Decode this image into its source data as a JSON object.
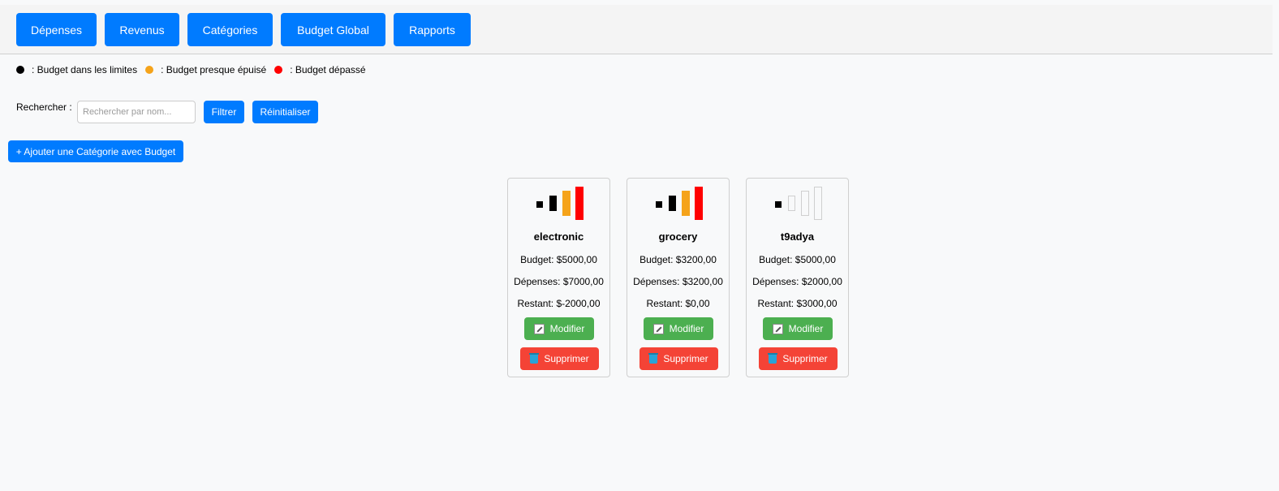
{
  "nav": {
    "items": [
      {
        "label": "Dépenses"
      },
      {
        "label": "Revenus"
      },
      {
        "label": "Catégories"
      },
      {
        "label": "Budget Global"
      },
      {
        "label": "Rapports"
      }
    ]
  },
  "legend": {
    "items": [
      {
        "label": ": Budget dans les limites",
        "color": "#000000"
      },
      {
        "label": ": Budget presque épuisé",
        "color": "#f5a31a"
      },
      {
        "label": ": Budget dépassé",
        "color": "#ff0000"
      }
    ]
  },
  "search": {
    "label": "Rechercher :",
    "placeholder": "Rechercher par nom...",
    "value": "",
    "filter_label": "Filtrer",
    "reset_label": "Réinitialiser"
  },
  "add_button_label": "+ Ajouter une Catégorie avec Budget",
  "cards": [
    {
      "name": "electronic",
      "budget": "Budget: $5000,00",
      "spent": "Dépenses: $7000,00",
      "remaining": "Restant: $-2000,00",
      "level": 4,
      "edit_label": "Modifier",
      "delete_label": "Supprimer"
    },
    {
      "name": "grocery",
      "budget": "Budget: $3200,00",
      "spent": "Dépenses: $3200,00",
      "remaining": "Restant: $0,00",
      "level": 4,
      "edit_label": "Modifier",
      "delete_label": "Supprimer"
    },
    {
      "name": "t9adya",
      "budget": "Budget: $5000,00",
      "spent": "Dépenses: $2000,00",
      "remaining": "Restant: $3000,00",
      "level": 1,
      "edit_label": "Modifier",
      "delete_label": "Supprimer"
    }
  ],
  "colors": {
    "primary": "#007bff",
    "success": "#4caf50",
    "danger": "#f44336",
    "bar_black": "#000000",
    "bar_orange": "#f5a31a",
    "bar_red": "#ff0000"
  }
}
